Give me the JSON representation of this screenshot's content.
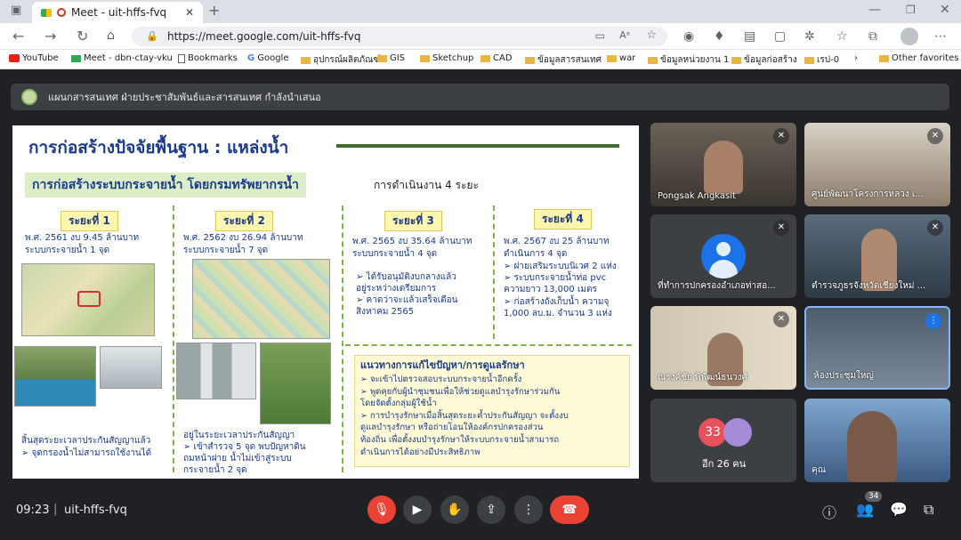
{
  "browser": {
    "tab_title": "Meet - uit-hffs-fvq",
    "url": "https://meet.google.com/uit-hffs-fvq",
    "bookmarks": [
      "YouTube",
      "Meet - dbn-ctay-vku",
      "Bookmarks",
      "Google",
      "อุปกรณ์ผลิตภัณฑ์",
      "GIS",
      "Sketchup",
      "CAD",
      "ข้อมูลสารสนเทศ",
      "war",
      "ข้อมูลหน่วยงาน 1",
      "ข้อมูลก่อสร้าง",
      "เรป-0"
    ],
    "other_favorites": "Other favorites"
  },
  "presentation": {
    "label": "แผนกสารสนเทศ ฝ่ายประชาสัมพันธ์และสารสนเทศ กำลังนำเสนอ"
  },
  "slide": {
    "title": "การก่อสร้างปัจจัยพื้นฐาน : แหล่งน้ำ",
    "subtitle": "การก่อสร้างระบบกระจายน้ำ โดยกรมทรัพยากรน้ำ",
    "phases_note": "การดำเนินงาน 4 ระยะ",
    "phases": [
      {
        "label": "ระยะที่ 1",
        "line1": "พ.ศ. 2561 งบ 9.45  ล้านบาท",
        "line2": "ระบบกระจายน้ำ 1 จุด"
      },
      {
        "label": "ระยะที่ 2",
        "line1": "พ.ศ. 2562 งบ 26.94  ล้านบาท",
        "line2": "ระบบกระจายน้ำ 7 จุด"
      },
      {
        "label": "ระยะที่ 3",
        "line1": "พ.ศ. 2565 งบ 35.64 ล้านบาท",
        "line2": "ระบบกระจายน้ำ 4 จุด"
      },
      {
        "label": "ระยะที่ 4",
        "line1": "พ.ศ. 2567 งบ 25 ล้านบาท",
        "line2": "ดำเนินการ 4 จุด"
      }
    ],
    "phase1_note": [
      "สิ้นสุดระยะเวลาประกันสัญญาแล้ว",
      "➢ จุดกรองน้ำไม่สามารถใช้งานได้"
    ],
    "phase2_note": [
      "อยู่ในระยะเวลาประกันสัญญา",
      "➢  เข้าสำรวจ 5 จุด พบปัญหาดิน",
      "     ถมหน้าฝาย น้ำไม่เข้าสู่ระบบ",
      "     กระจายน้ำ 2 จุด"
    ],
    "phase3_items": [
      "➢ ได้รับอนุมัติงบกลางแล้ว",
      "   อยู่ระหว่างเตรียมการ",
      "➢ คาดว่าจะแล้วเสร็จเดือน",
      "   สิงหาคม 2565"
    ],
    "phase4_items": [
      "➢ ฝายเสริมระบบนิเวศ 2 แห่ง",
      "➢ ระบบกระจายน้ำท่อ pvc",
      "   ความยาว 13,000 เมตร",
      "➢ ก่อสร้างถังเก็บน้ำ ความจุ",
      "   1,000 ลบ.ม. จำนวน 3 แห่ง"
    ],
    "solution_title": "แนวทางการแก้ไขปัญหา/การดูแลรักษา",
    "solution_items": [
      "➢  จะเข้าไปตรวจสอบระบบกระจายน้ำอีกครั้ง",
      "➢  พูดคุยกับผู้นำชุมชนเพื่อให้ช่วยดูแลบำรุงรักษาร่วมกัน",
      "     โดยจัดตั้งกลุ่มผู้ใช้น้ำ",
      "➢  การบำรุงรักษาเมื่อสิ้นสุดระยะค้ำประกันสัญญา จะตั้งงบ",
      "     ดูแลบำรุงรักษา หรือถ่ายโอนให้องค์กรปกครองส่วน",
      "     ท้องถิ่น เพื่อตั้งงบบำรุงรักษาให้ระบบกระจายน้ำสามารถ",
      "     ดำเนินการได้อย่างมีประสิทธิภาพ"
    ]
  },
  "participants": [
    {
      "name": "Pongsak Angkasit"
    },
    {
      "name": "ศูนย์พัฒนาโครงการหลวง เ..."
    },
    {
      "name": "ที่ทำการปกครองอำเภอท่าสอ..."
    },
    {
      "name": "ตำรวจภูธรจังหวัดเชียงใหม่ ..."
    },
    {
      "name": "ณรงค์ชัย พิพัฒน์ธนวงศ์"
    },
    {
      "name": "ห้องประชุมใหญ่"
    },
    {
      "name": "อีก 26 คน",
      "badge": "33"
    },
    {
      "name": "คุณ"
    }
  ],
  "footer": {
    "time": "09:23",
    "meeting_code": "uit-hffs-fvq",
    "people_count": "34"
  },
  "colors": {
    "end_call": "#ea4335",
    "mic_off": "#ea4335",
    "meet_bg": "#202124"
  }
}
